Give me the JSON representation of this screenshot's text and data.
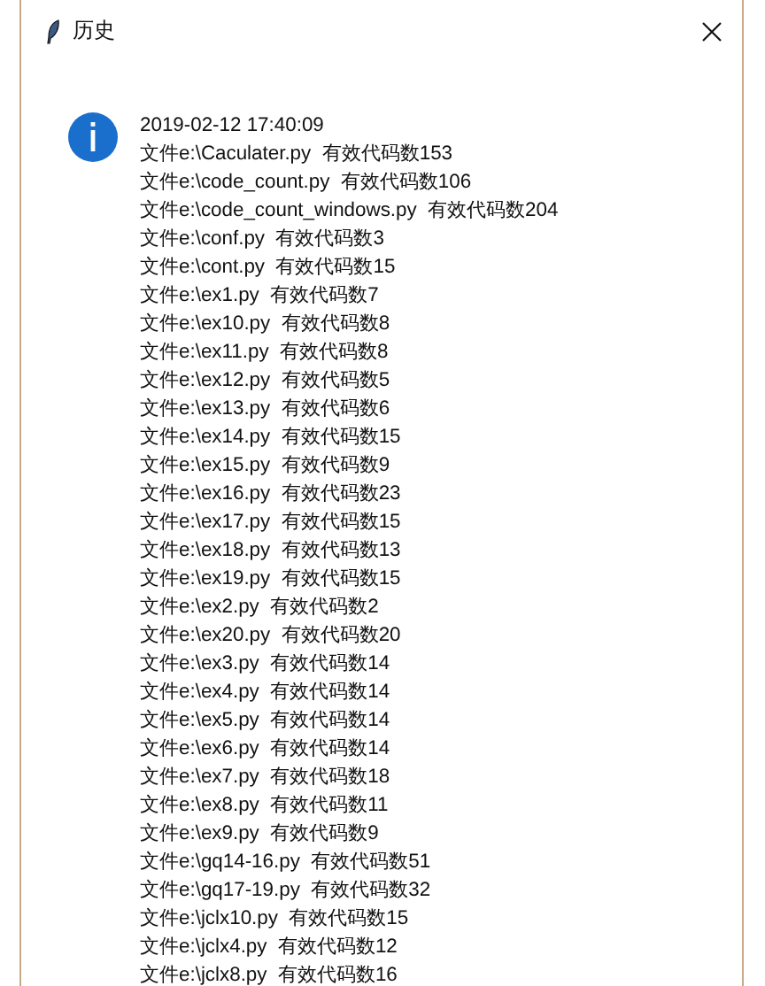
{
  "window": {
    "title": "历史"
  },
  "message": {
    "lines": [
      "2019-02-12 17:40:09",
      "文件e:\\Caculater.py  有效代码数153",
      "文件e:\\code_count.py  有效代码数106",
      "文件e:\\code_count_windows.py  有效代码数204",
      "文件e:\\conf.py  有效代码数3",
      "文件e:\\cont.py  有效代码数15",
      "文件e:\\ex1.py  有效代码数7",
      "文件e:\\ex10.py  有效代码数8",
      "文件e:\\ex11.py  有效代码数8",
      "文件e:\\ex12.py  有效代码数5",
      "文件e:\\ex13.py  有效代码数6",
      "文件e:\\ex14.py  有效代码数15",
      "文件e:\\ex15.py  有效代码数9",
      "文件e:\\ex16.py  有效代码数23",
      "文件e:\\ex17.py  有效代码数15",
      "文件e:\\ex18.py  有效代码数13",
      "文件e:\\ex19.py  有效代码数15",
      "文件e:\\ex2.py  有效代码数2",
      "文件e:\\ex20.py  有效代码数20",
      "文件e:\\ex3.py  有效代码数14",
      "文件e:\\ex4.py  有效代码数14",
      "文件e:\\ex5.py  有效代码数14",
      "文件e:\\ex6.py  有效代码数14",
      "文件e:\\ex7.py  有效代码数18",
      "文件e:\\ex8.py  有效代码数11",
      "文件e:\\ex9.py  有效代码数9",
      "文件e:\\gq14-16.py  有效代码数51",
      "文件e:\\gq17-19.py  有效代码数32",
      "文件e:\\jclx10.py  有效代码数15",
      "文件e:\\jclx4.py  有效代码数12",
      "文件e:\\jclx8.py  有效代码数16"
    ]
  }
}
